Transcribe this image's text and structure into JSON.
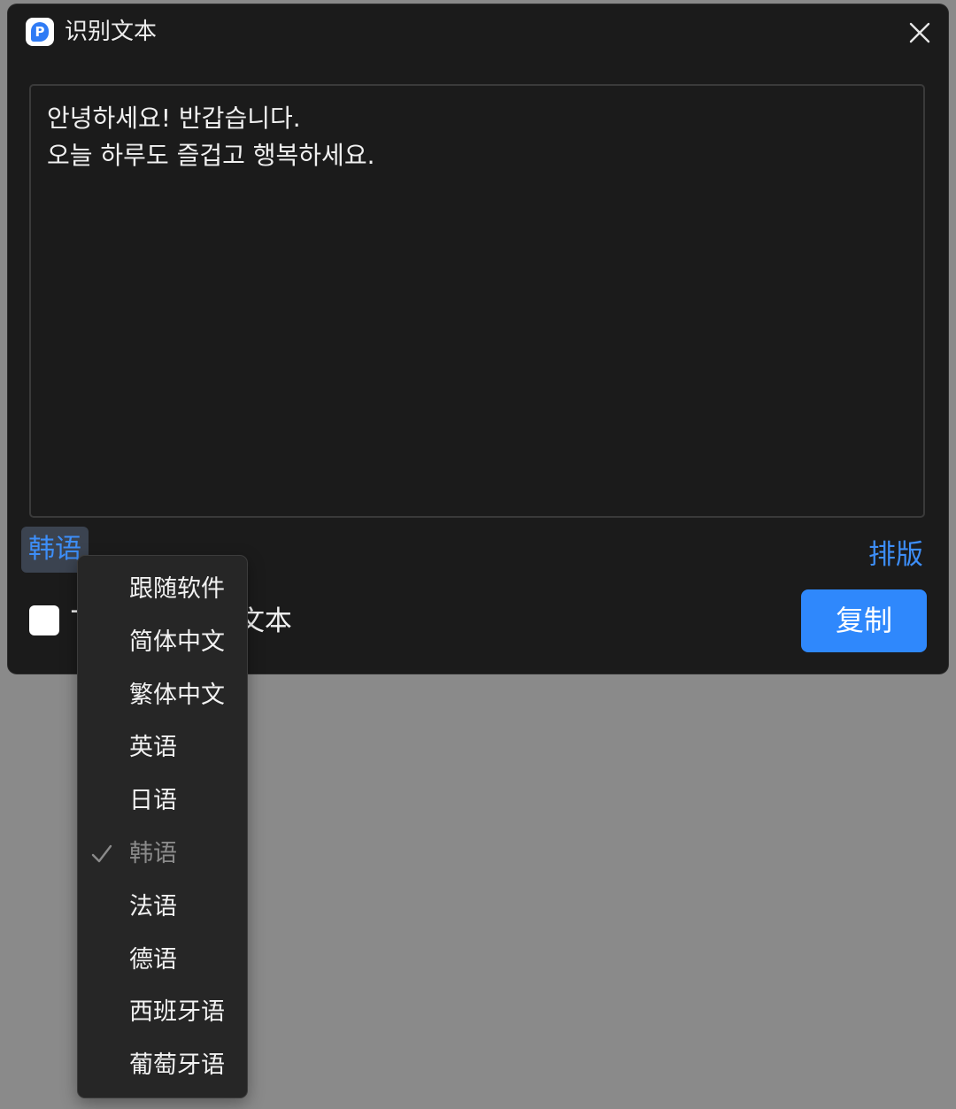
{
  "window": {
    "title": "识别文本",
    "logo_letter": "P",
    "close_icon": "close-icon"
  },
  "textarea": {
    "lines": [
      "안녕하세요! 반갑습니다.",
      "오늘 하루도 즐겁고 행복하세요."
    ]
  },
  "language_button": {
    "label": "韩语"
  },
  "layout_button": {
    "label": "排版"
  },
  "checkbox": {
    "checked": false,
    "label_prefix": "T",
    "label_suffix": "文本"
  },
  "copy_button": {
    "label": "复制"
  },
  "language_menu": {
    "selected": "韩语",
    "items": [
      {
        "label": "跟随软件"
      },
      {
        "label": "简体中文"
      },
      {
        "label": "繁体中文"
      },
      {
        "label": "英语"
      },
      {
        "label": "日语"
      },
      {
        "label": "韩语",
        "selected": true
      },
      {
        "label": "法语"
      },
      {
        "label": "德语"
      },
      {
        "label": "西班牙语"
      },
      {
        "label": "葡萄牙语"
      }
    ]
  },
  "colors": {
    "accent": "#2f88fc",
    "link": "#3d8ef8",
    "window_bg": "#1b1b1b",
    "menu_bg": "#262626",
    "backdrop": "#8a8a8a"
  }
}
